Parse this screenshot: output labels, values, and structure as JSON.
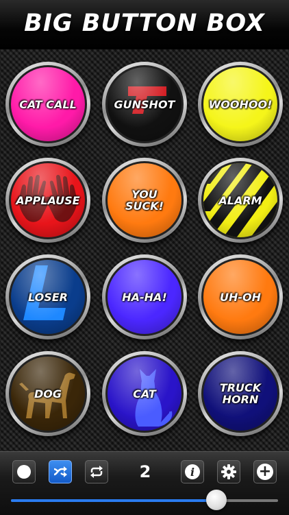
{
  "app": {
    "title": "BIG BUTTON BOX"
  },
  "buttons": [
    {
      "label": "CAT CALL",
      "color": "#ff1aa8",
      "art": "none"
    },
    {
      "label": "GUNSHOT",
      "color": "#111111",
      "art": "gun"
    },
    {
      "label": "WOOHOO!",
      "color": "#f5f51a",
      "art": "none"
    },
    {
      "label": "APPLAUSE",
      "color": "#e8141a",
      "art": "hands"
    },
    {
      "label": "YOU\nSUCK!",
      "color": "#ff7a10",
      "art": "none"
    },
    {
      "label": "ALARM",
      "color": "#f2ee14",
      "art": "stripes"
    },
    {
      "label": "LOSER",
      "color": "#0a3d8c",
      "art": "L"
    },
    {
      "label": "HA-HA!",
      "color": "#4b27ff",
      "art": "none"
    },
    {
      "label": "UH-OH",
      "color": "#ff7a10",
      "art": "none"
    },
    {
      "label": "DOG",
      "color": "#3a2608",
      "art": "dog"
    },
    {
      "label": "CAT",
      "color": "#2a14c9",
      "art": "cat"
    },
    {
      "label": "TRUCK\nHORN",
      "color": "#10107a",
      "art": "none"
    }
  ],
  "toolbar": {
    "record_icon": "record-dot-icon",
    "shuffle_icon": "shuffle-icon",
    "repeat_icon": "repeat-icon",
    "counter": "2",
    "info_icon": "info-icon",
    "settings_icon": "gear-icon",
    "add_icon": "plus-icon",
    "accent": "#2a7cf0"
  },
  "volume": {
    "level": 0.77
  }
}
